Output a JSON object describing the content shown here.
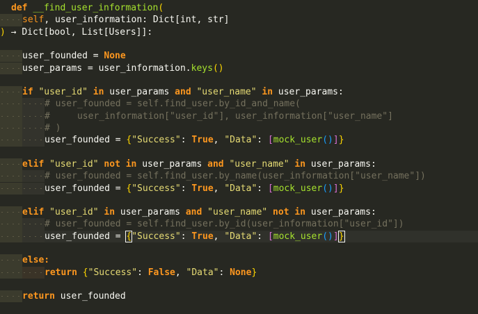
{
  "theme": {
    "background": "#272822",
    "keyword": "#fd971f",
    "string": "#e6db74",
    "comment": "#75715e",
    "type": "#66d9ef"
  },
  "code": {
    "l1_def": "def",
    "l1_name": "__find_user_information",
    "l1_paren": "(",
    "l2_self": "self",
    "l2_rest": ", user_information: Dict[int, str]",
    "l3_close": ")",
    "l3_arrow": " → ",
    "l3_type": "Dict[bool, List[Users]]:",
    "l5_var": "user_founded",
    "l5_eq": " = ",
    "l5_val": "None",
    "l6_var": "user_params",
    "l6_eq": " = ",
    "l6_obj": "user_information.",
    "l6_fn": "keys",
    "l6_call": "()",
    "l8_if": "if",
    "l8_s1": " \"user_id\"",
    "l8_in1": " in",
    "l8_v1": " user_params",
    "l8_and": " and",
    "l8_s2": " \"user_name\"",
    "l8_in2": " in",
    "l8_v2": " user_params:",
    "l9_cm": "# user_founded = self.find_user.by_id_and_name(",
    "l10_cm": "#     user_information[\"user_id\"], user_information[\"user_name\"]",
    "l11_cm": "# )",
    "l12_var": "user_founded",
    "l12_eq": " = ",
    "l12_ob": "{",
    "l12_s1": "\"Success\"",
    "l12_c1": ": ",
    "l12_t": "True",
    "l12_c2": ", ",
    "l12_s2": "\"Data\"",
    "l12_c3": ": ",
    "l12_lb": "[",
    "l12_fn": "mock_user",
    "l12_call": "()",
    "l12_rb": "]",
    "l12_cb": "}",
    "l14_elif": "elif",
    "l14_s1": " \"user_id\"",
    "l14_not": " not",
    "l14_in1": " in",
    "l14_v1": " user_params",
    "l14_and": " and",
    "l14_s2": " \"user_name\"",
    "l14_in2": " in",
    "l14_v2": " user_params:",
    "l15_cm": "# user_founded = self.find_user.by_name(user_information[\"user_name\"])",
    "l16_var": "user_founded",
    "l16_eq": " = ",
    "l16_ob": "{",
    "l16_s1": "\"Success\"",
    "l16_c1": ": ",
    "l16_t": "True",
    "l16_c2": ", ",
    "l16_s2": "\"Data\"",
    "l16_c3": ": ",
    "l16_lb": "[",
    "l16_fn": "mock_user",
    "l16_call": "()",
    "l16_rb": "]",
    "l16_cb": "}",
    "l18_elif": "elif",
    "l18_s1": " \"user_id\"",
    "l18_in1": " in",
    "l18_v1": " user_params",
    "l18_and": " and",
    "l18_s2": " \"user_name\"",
    "l18_not": " not",
    "l18_in2": " in",
    "l18_v2": " user_params:",
    "l19_cm": "# user_founded = self.find_user.by_id(user_information[\"user_id\"])",
    "l20_var": "user_founded",
    "l20_eq": " = ",
    "l20_ob": "{",
    "l20_s1": "\"Success\"",
    "l20_c1": ": ",
    "l20_t": "True",
    "l20_c2": ", ",
    "l20_s2": "\"Data\"",
    "l20_c3": ": ",
    "l20_lb": "[",
    "l20_fn": "mock_user",
    "l20_call": "()",
    "l20_rb": "]",
    "l20_cb": "}",
    "l22_else": "else:",
    "l23_ret": "return",
    "l23_ob": " {",
    "l23_s1": "\"Success\"",
    "l23_c1": ": ",
    "l23_f": "False",
    "l23_c2": ", ",
    "l23_s2": "\"Data\"",
    "l23_c3": ": ",
    "l23_n": "None",
    "l23_cb": "}",
    "l25_ret": "return",
    "l25_var": " user_founded"
  }
}
